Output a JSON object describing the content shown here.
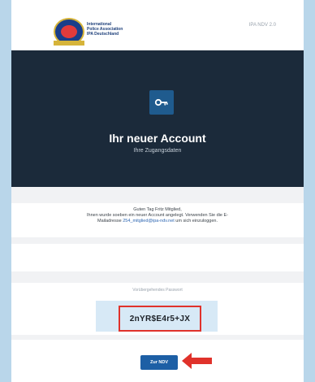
{
  "header": {
    "org_name_line1": "International",
    "org_name_line2": "Police Association",
    "org_name_line3": "IPA Deutschland",
    "version": "IPA NDV 2.0"
  },
  "hero": {
    "icon": "key-icon",
    "title": "Ihr neuer Account",
    "subtitle": "Ihre Zugangsdaten"
  },
  "message": {
    "greeting": "Guten Tag Fritz Mitglied,",
    "body_part1": "Ihnen wurde soeben ein neuer Account angelegt. Verwenden Sie die E-",
    "body_part2_prefix": "Mailadresse ",
    "email": "254_mitglied@ipa-ndv.net",
    "body_part2_suffix": " um sich einzuloggen."
  },
  "password": {
    "label": "Vorübergehendes Passwort",
    "value": "2nYR$E4r5+JX"
  },
  "actions": {
    "ndv_button_label": "Zur NDV"
  },
  "colors": {
    "page_bg": "#b9d6ea",
    "hero_bg": "#1b2a3a",
    "key_icon_bg": "#1f5b8e",
    "highlight_border": "#e0322b",
    "button_bg": "#1d5fa5",
    "arrow": "#e0322b"
  }
}
